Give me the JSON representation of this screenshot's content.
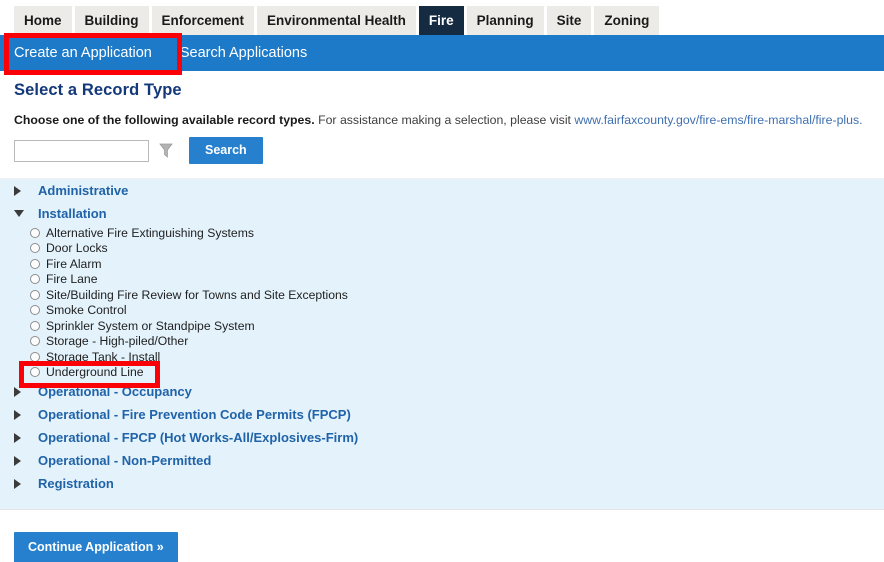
{
  "module_tabs": [
    {
      "label": "Home",
      "active": false
    },
    {
      "label": "Building",
      "active": false
    },
    {
      "label": "Enforcement",
      "active": false
    },
    {
      "label": "Environmental Health",
      "active": false
    },
    {
      "label": "Fire",
      "active": true
    },
    {
      "label": "Planning",
      "active": false
    },
    {
      "label": "Site",
      "active": false
    },
    {
      "label": "Zoning",
      "active": false
    }
  ],
  "subnav": {
    "items": [
      {
        "label": "Create an Application",
        "selected": true
      },
      {
        "label": "Search Applications",
        "selected": false
      }
    ]
  },
  "page": {
    "title": "Select a Record Type",
    "instructions_bold": "Choose one of the following available record types.",
    "instructions_rest": "For assistance making a selection, please visit",
    "instructions_link": "www.fairfaxcounty.gov/fire-ems/fire-marshal/fire-plus."
  },
  "search": {
    "value": "",
    "placeholder": "",
    "filter_icon": "funnel-icon",
    "button_label": "Search"
  },
  "record_types": {
    "groups": [
      {
        "label": "Administrative",
        "expanded": false,
        "items": []
      },
      {
        "label": "Installation",
        "expanded": true,
        "items": [
          "Alternative Fire Extinguishing Systems",
          "Door Locks",
          "Fire Alarm",
          "Fire Lane",
          "Site/Building Fire Review for Towns and Site Exceptions",
          "Smoke Control",
          "Sprinkler System or Standpipe System",
          "Storage - High-piled/Other",
          "Storage Tank - Install",
          "Underground Line"
        ]
      },
      {
        "label": "Operational - Occupancy",
        "expanded": false,
        "items": []
      },
      {
        "label": "Operational - Fire Prevention Code Permits (FPCP)",
        "expanded": false,
        "items": []
      },
      {
        "label": "Operational - FPCP (Hot Works-All/Explosives-Firm)",
        "expanded": false,
        "items": []
      },
      {
        "label": "Operational - Non-Permitted",
        "expanded": false,
        "items": []
      },
      {
        "label": "Registration",
        "expanded": false,
        "items": []
      }
    ]
  },
  "footer": {
    "continue_label": "Continue Application »"
  },
  "colors": {
    "subnav_blue": "#1d7ac8",
    "active_tab_navy": "#152b42",
    "panel_bg": "#e3f2fb",
    "button_blue": "#2680ce",
    "link_blue": "#3f6fb0",
    "group_label_blue": "#2063a8",
    "title_navy": "#13397a",
    "annotation_red": "#fb0007",
    "tab_bg": "#edebe7"
  }
}
